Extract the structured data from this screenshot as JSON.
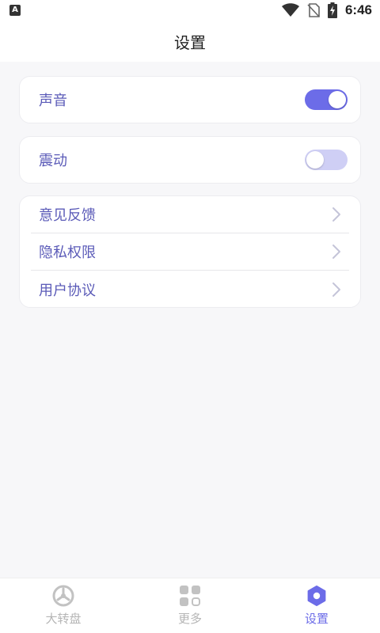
{
  "status_bar": {
    "time": "6:46",
    "app_badge": "A"
  },
  "header": {
    "title": "设置"
  },
  "settings": {
    "sound": {
      "label": "声音",
      "enabled": true
    },
    "vibration": {
      "label": "震动",
      "enabled": false
    }
  },
  "list": {
    "items": [
      {
        "label": "意见反馈",
        "icon": "chevron-right-icon"
      },
      {
        "label": "隐私权限",
        "icon": "chevron-right-icon"
      },
      {
        "label": "用户协议",
        "icon": "chevron-right-icon"
      }
    ]
  },
  "bottom_nav": {
    "items": [
      {
        "label": "大转盘",
        "icon": "wheel-icon",
        "active": false
      },
      {
        "label": "更多",
        "icon": "grid-icon",
        "active": false
      },
      {
        "label": "设置",
        "icon": "gear-icon",
        "active": true
      }
    ]
  },
  "colors": {
    "accent": "#6c6ce8",
    "accent_light": "#cfcff5",
    "label": "#5b5bb8",
    "inactive": "#b5b5b5"
  }
}
